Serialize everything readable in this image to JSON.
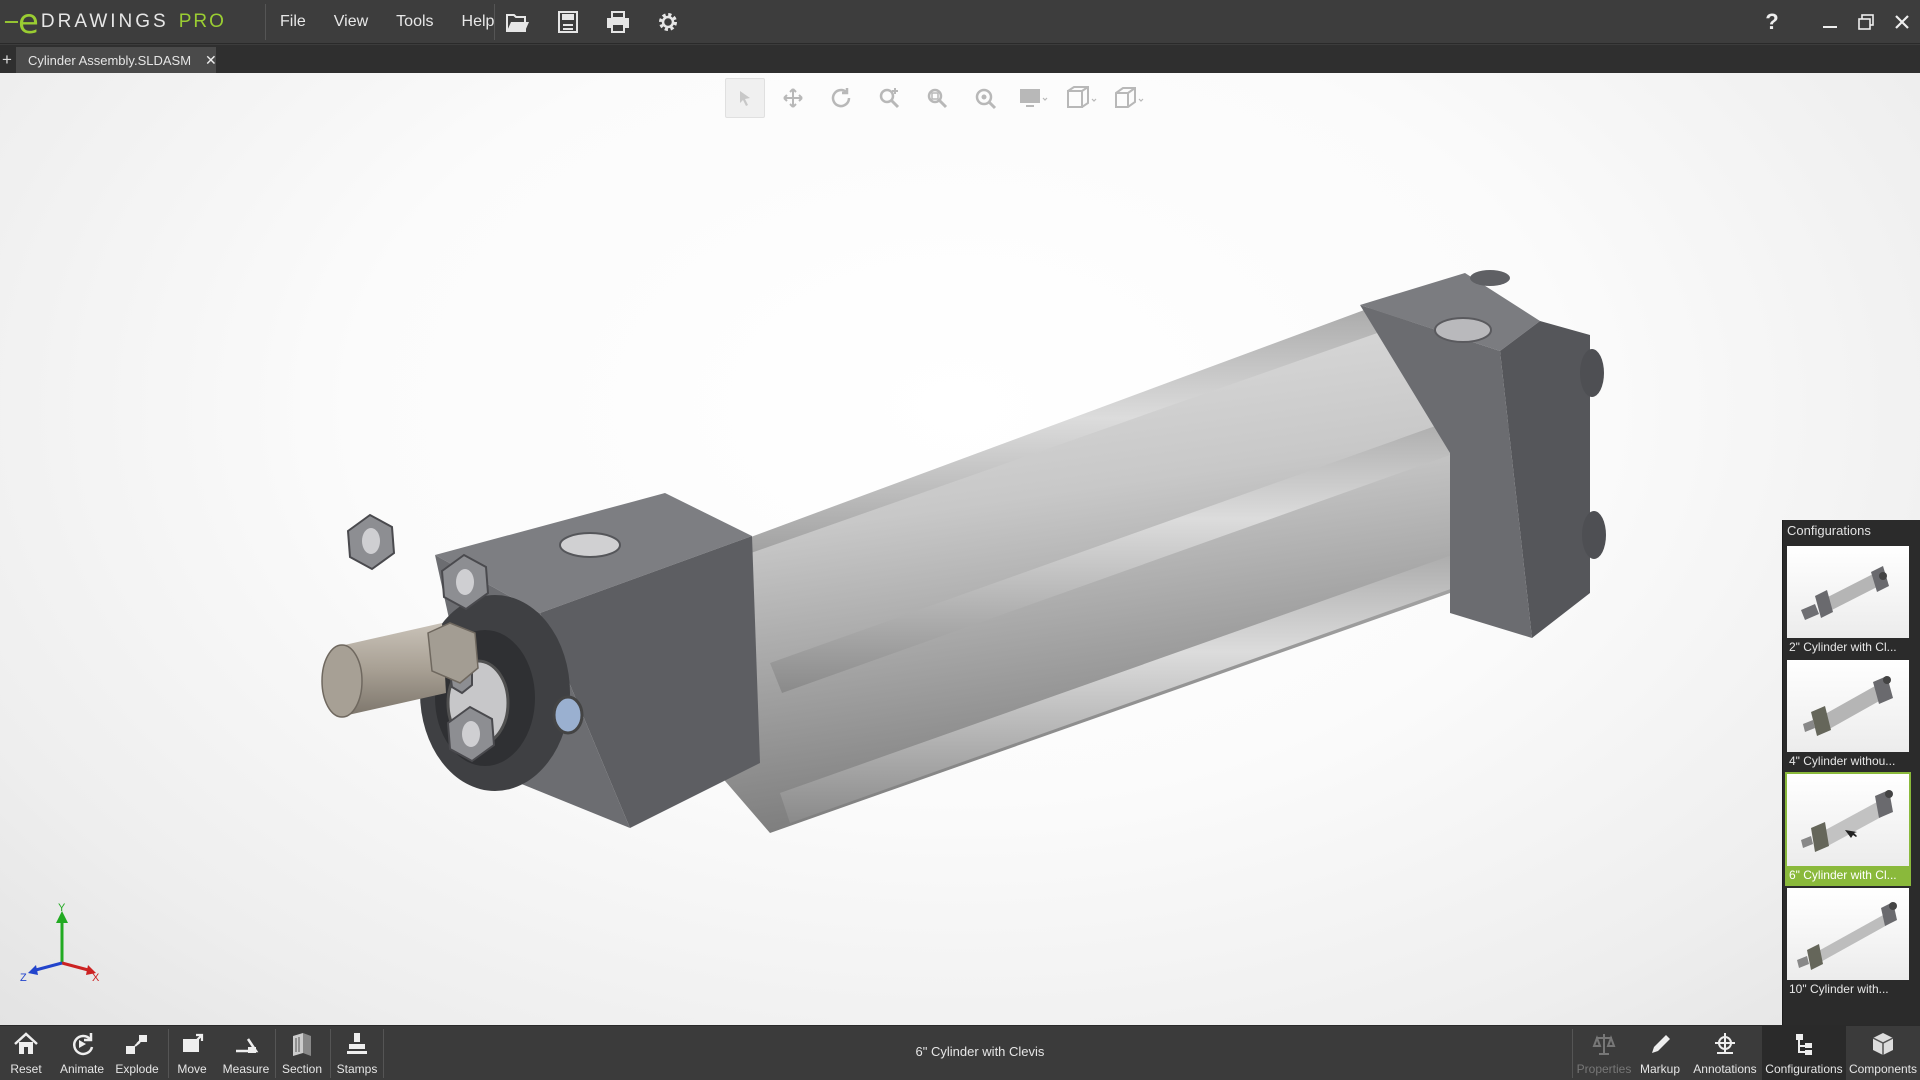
{
  "app": {
    "brand": "DRAWINGS",
    "brand_mark": "e",
    "edition": "PRO"
  },
  "menu": {
    "file": "File",
    "view": "View",
    "tools": "Tools",
    "help": "Help"
  },
  "quick_tools": [
    "open-icon",
    "save-icon",
    "print-icon",
    "gear-icon"
  ],
  "window": {
    "help": "?"
  },
  "tab": {
    "title": "Cylinder Assembly.SLDASM",
    "new_tab": "+",
    "close": "✕"
  },
  "view_toolbar": [
    "select",
    "pan",
    "rotate",
    "zoom",
    "zoom-to-area",
    "zoom-to-fit",
    "display-style",
    "view-orientation",
    "view-cube"
  ],
  "triad": {
    "x": "X",
    "y": "Y",
    "z": "Z"
  },
  "configurations": {
    "title": "Configurations",
    "items": [
      {
        "label": "2\" Cylinder with Cl...",
        "selected": false
      },
      {
        "label": "4\" Cylinder withou...",
        "selected": false
      },
      {
        "label": "6\" Cylinder with Cl...",
        "selected": true
      },
      {
        "label": "10\" Cylinder with...",
        "selected": false
      }
    ]
  },
  "bottom_left": {
    "reset": "Reset",
    "animate": "Animate",
    "explode": "Explode",
    "move": "Move",
    "measure": "Measure",
    "section": "Section",
    "stamps": "Stamps"
  },
  "status": "6\" Cylinder with Clevis",
  "bottom_right": {
    "properties": "Properties",
    "markup": "Markup",
    "annotations": "Annotations",
    "configurations": "Configurations",
    "components": "Components"
  },
  "colors": {
    "accent": "#8ab93b",
    "brand_green": "#9acd32",
    "toolbar_bg": "#3b3b3b"
  }
}
